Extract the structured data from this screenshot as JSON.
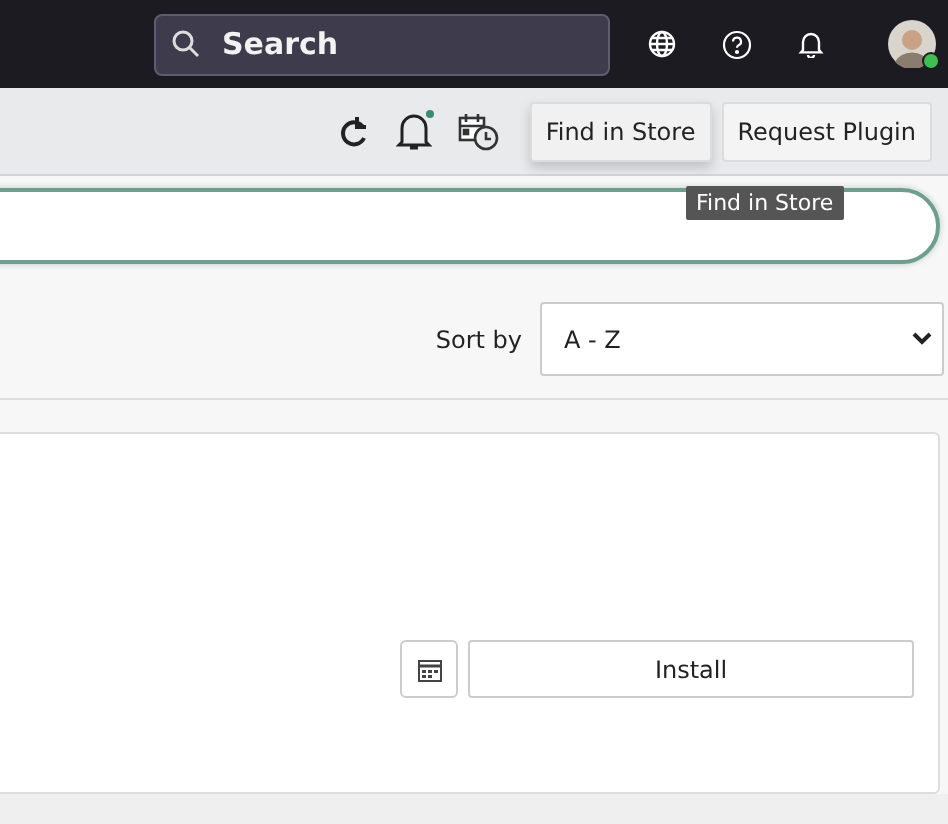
{
  "top_bar": {
    "search": {
      "placeholder": "Search"
    },
    "user": {
      "online": true
    }
  },
  "toolbar": {
    "notifications": {
      "unread": true
    },
    "buttons": [
      {
        "label": "Find in Store",
        "hovered": true
      },
      {
        "label": "Request Plugin",
        "hovered": false
      }
    ],
    "tooltip": "Find in Store"
  },
  "filter_bar": {
    "sort_label": "Sort by",
    "sort_value": "A - Z"
  },
  "plugin_card": {
    "install_button": "Install"
  }
}
